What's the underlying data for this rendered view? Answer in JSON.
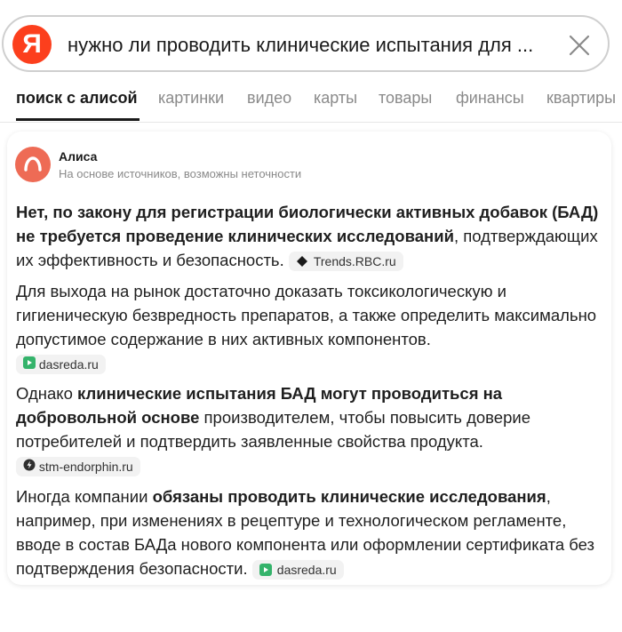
{
  "search": {
    "logo": "Я",
    "query": "нужно ли проводить клинические испытания для ..."
  },
  "tabs": [
    {
      "label": "поиск с алисой",
      "active": true
    },
    {
      "label": "картинки"
    },
    {
      "label": "видео"
    },
    {
      "label": "карты"
    },
    {
      "label": "товары"
    },
    {
      "label": "финансы"
    },
    {
      "label": "квартиры"
    }
  ],
  "answer": {
    "author": "Алиса",
    "disclaimer": "На основе источников, возможны неточности",
    "p1": {
      "bold": "Нет, по закону для регистрации биологически активных добавок (БАД) не требуется проведение клинических исследований",
      "rest": ", подтверждающих их эффективность и безопасность.",
      "source": "Trends.RBC.ru"
    },
    "p2": {
      "text": "Для выхода на рынок достаточно доказать токсикологическую и гигиеническую безвредность препаратов, а также определить максимально допустимое содержание в них активных компонентов.",
      "source": "dasreda.ru"
    },
    "p3": {
      "pre": "Однако ",
      "bold": "клинические испытания БАД могут проводиться на добровольной основе",
      "rest": " производителем, чтобы повысить доверие потребителей и подтвердить заявленные свойства продукта.",
      "source": "stm-endorphin.ru"
    },
    "p4": {
      "pre": "Иногда компании ",
      "bold": "обязаны проводить клинические исследования",
      "rest": ", например, при изменениях в рецептуре и технологическом регламенте, вводе в состав БАДа нового компонента или оформлении сертификата без подтверждения безопасности.",
      "source": "dasreda.ru"
    }
  },
  "colors": {
    "yandex_red": "#fc3f1d",
    "alice_avatar": "#ee6b55",
    "source_green": "#34b36b"
  }
}
